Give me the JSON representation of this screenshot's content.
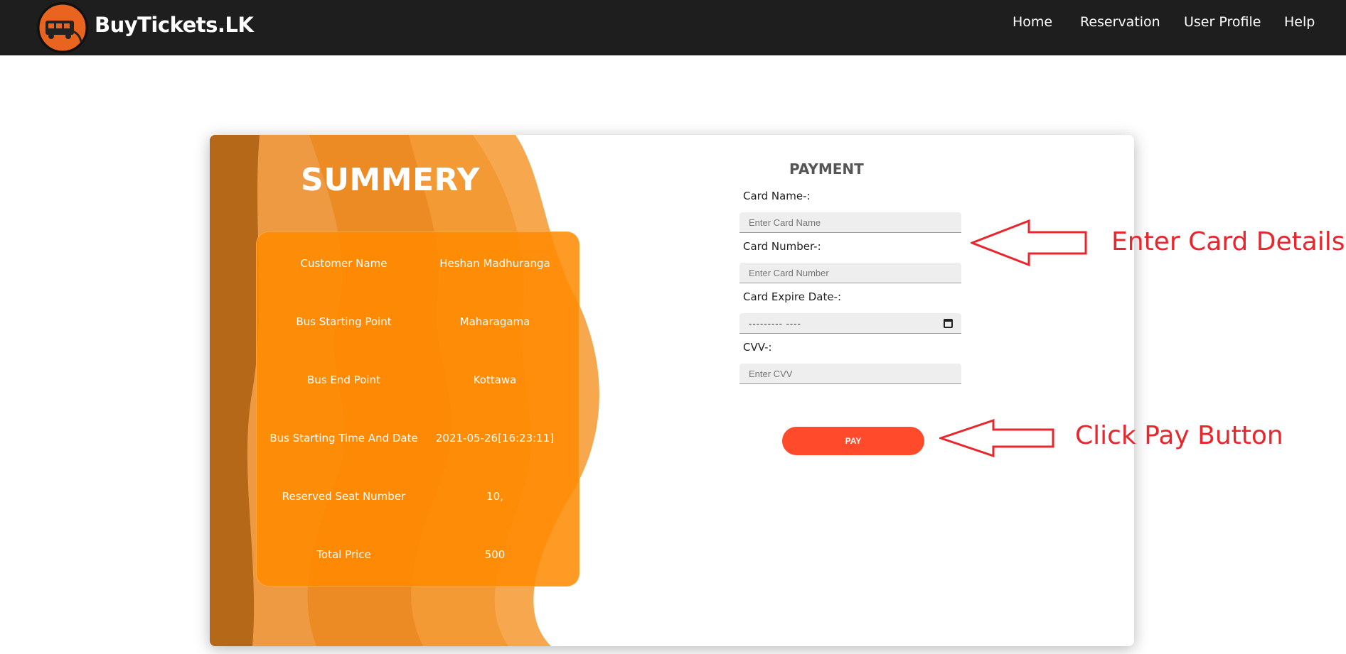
{
  "navbar": {
    "brand": "BuyTickets.LK",
    "logo_icon": "bus-logo-icon",
    "items": [
      {
        "label": "Home"
      },
      {
        "label": "Reservation"
      },
      {
        "label": "User Profile"
      },
      {
        "label": "Help"
      }
    ]
  },
  "summary": {
    "title": "SUMMERY",
    "rows": [
      {
        "label": "Customer Name",
        "value": "Heshan Madhuranga"
      },
      {
        "label": "Bus Starting Point",
        "value": "Maharagama"
      },
      {
        "label": "Bus End Point",
        "value": "Kottawa"
      },
      {
        "label": "Bus Starting Time And Date",
        "value": "2021-05-26[16:23:11]"
      },
      {
        "label": "Reserved Seat Number",
        "value": "10,"
      },
      {
        "label": "Total Price",
        "value": "500"
      }
    ]
  },
  "payment": {
    "title": "PAYMENT",
    "card_name": {
      "label": "Card Name-:",
      "placeholder": "Enter Card Name",
      "value": ""
    },
    "card_number": {
      "label": "Card Number-:",
      "placeholder": "Enter Card Number",
      "value": ""
    },
    "expire_date": {
      "label": "Card Expire Date-:",
      "display": "---------  ----"
    },
    "cvv": {
      "label": "CVV-:",
      "placeholder": "Enter CVV",
      "value": ""
    },
    "pay_button": "PAY"
  },
  "annotations": {
    "card_details": "Enter Card Details",
    "pay_button": "Click Pay Button",
    "color": "#e8262c"
  },
  "colors": {
    "navbar": "#1e1e1e",
    "summary_box": "#ff8900",
    "pay_button": "#ff4a2c"
  }
}
